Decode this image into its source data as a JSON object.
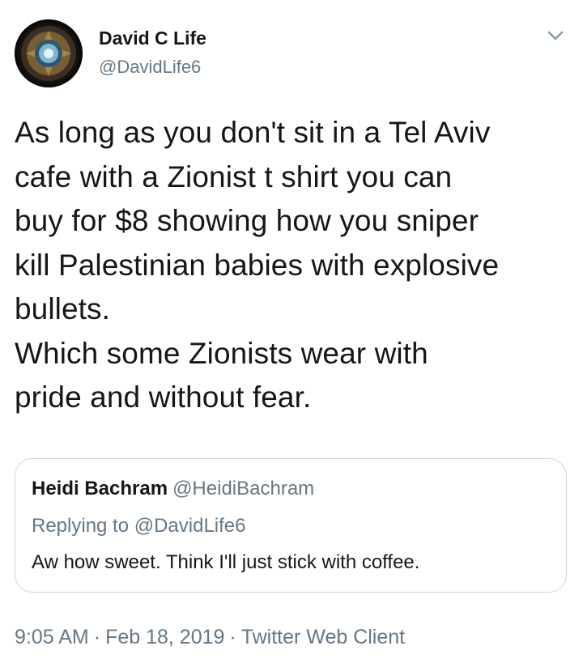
{
  "author": {
    "name": "David C Life",
    "handle": "@DavidLife6"
  },
  "menu_icon": "chevron-down-icon",
  "tweet": {
    "text": "As long as you don't sit in a Tel Aviv\ncafe with a Zionist t shirt you can\nbuy for $8 showing how you sniper\nkill Palestinian babies with explosive\nbullets.\nWhich some Zionists wear with\npride and without fear."
  },
  "quoted_tweet": {
    "name": "Heidi Bachram",
    "handle": "@HeidiBachram",
    "replying_to": "Replying to @DavidLife6",
    "text": "Aw how sweet. Think I'll just stick with coffee."
  },
  "meta": {
    "time": "9:05 AM",
    "separator": "·",
    "date": "Feb 18, 2019",
    "client": "Twitter Web Client"
  },
  "colors": {
    "text": "#14171a",
    "secondary": "#657786",
    "border": "#ccd6dd"
  }
}
